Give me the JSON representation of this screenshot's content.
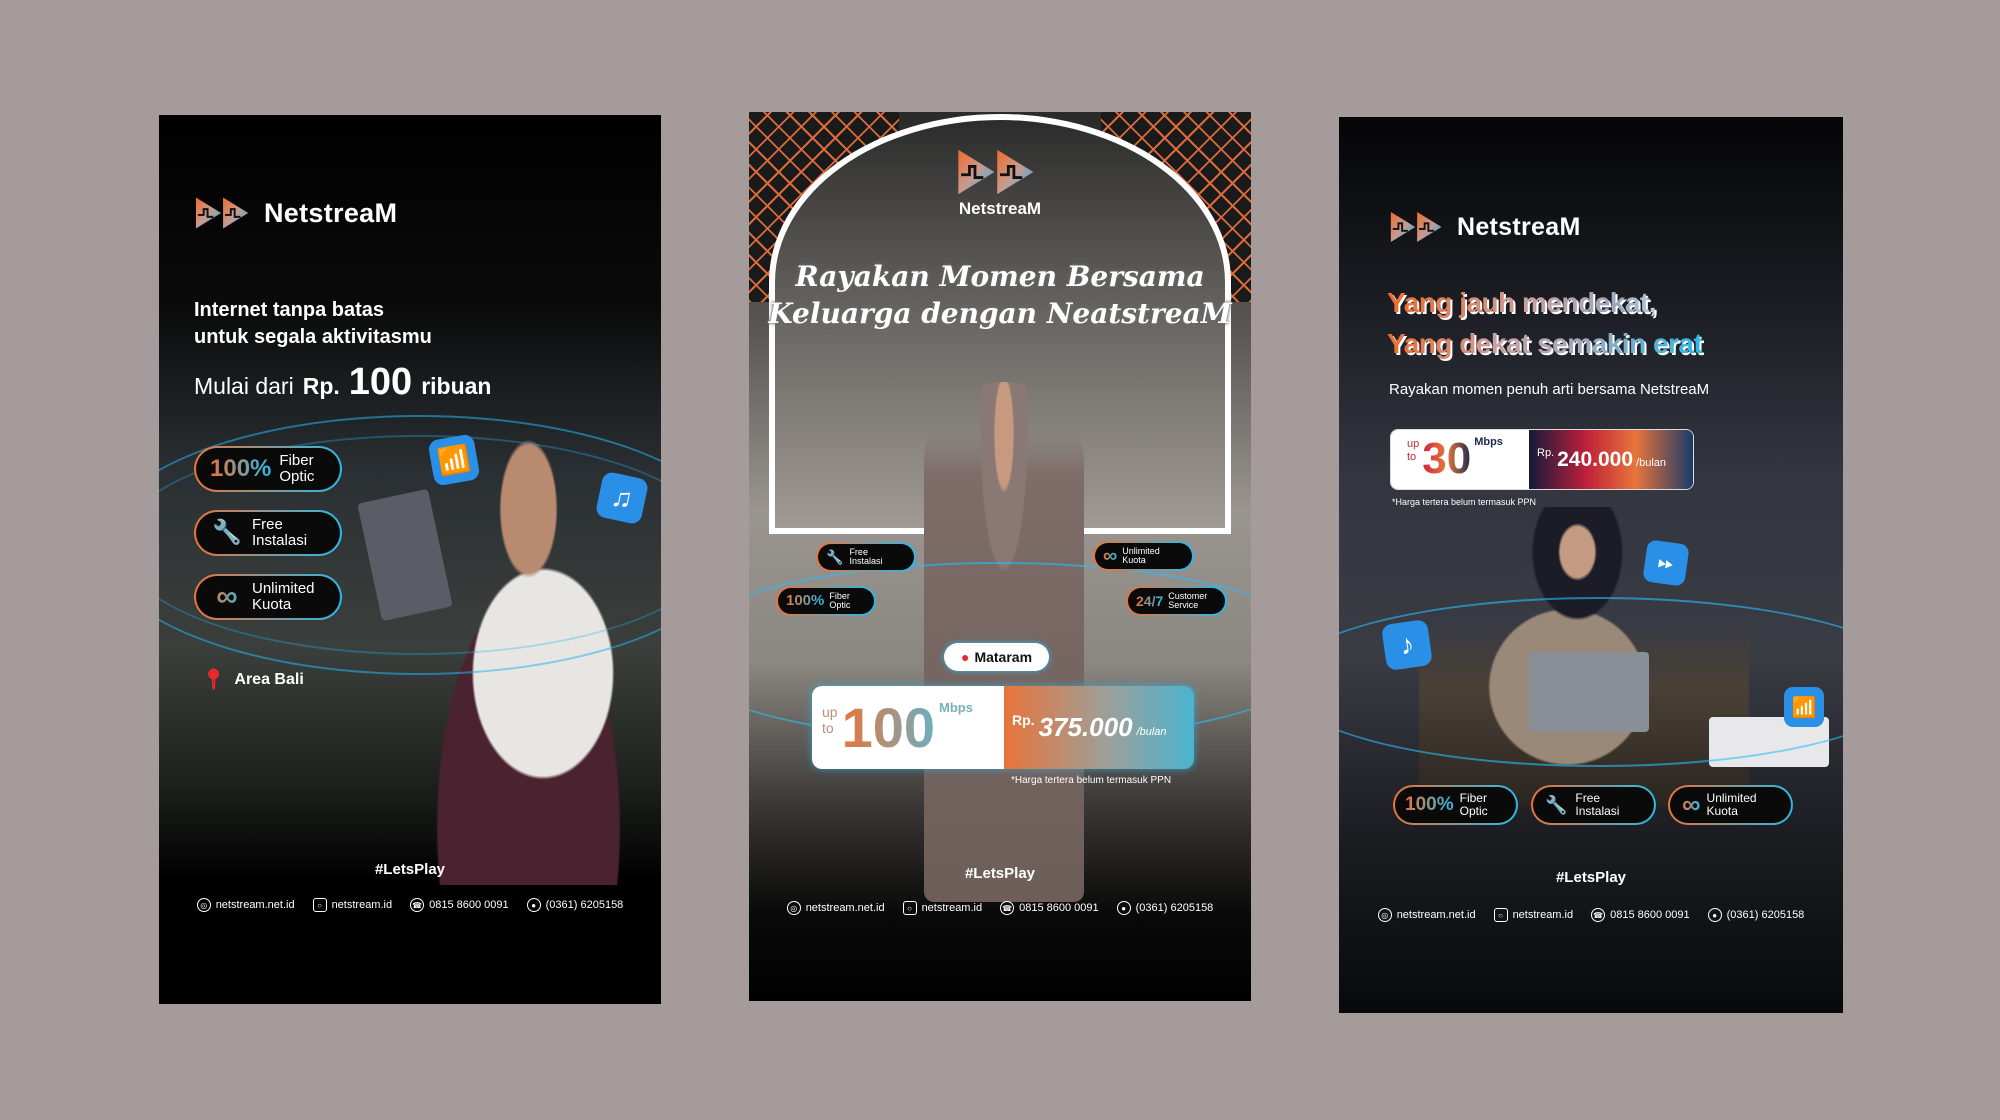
{
  "brand": "NetstreaM",
  "hashtag": "#LetsPlay",
  "contacts": {
    "website": "netstream.net.id",
    "instagram": "netstream.id",
    "whatsapp": "0815 8600 0091",
    "phone": "(0361) 6205158"
  },
  "features": {
    "fiber": {
      "big": "100%",
      "line1": "Fiber",
      "line2": "Optic"
    },
    "install": {
      "line1": "Free",
      "line2": "Instalasi"
    },
    "quota": {
      "line1": "Unlimited",
      "line2": "Kuota"
    },
    "service": {
      "big": "24/7",
      "line1": "Customer",
      "line2": "Service"
    }
  },
  "poster1": {
    "headline1": "Internet tanpa batas",
    "headline2": "untuk segala aktivitasmu",
    "price_prefix": "Mulai dari",
    "price_currency": "Rp.",
    "price_value": "100",
    "price_suffix": "ribuan",
    "area": "Area Bali"
  },
  "poster2": {
    "title1": "Rayakan Momen Bersama",
    "title2": "Keluarga dengan NeatstreaM",
    "location": "Mataram",
    "speed_prefix1": "up",
    "speed_prefix2": "to",
    "speed": "100",
    "speed_unit": "Mbps",
    "price_currency": "Rp.",
    "price": "375.000",
    "price_period": "/bulan",
    "note": "*Harga tertera belum termasuk PPN"
  },
  "poster3": {
    "headline1": "Yang jauh mendekat,",
    "headline2": "Yang dekat semakin erat",
    "subtitle": "Rayakan momen penuh arti bersama NetstreaM",
    "speed_prefix1": "up",
    "speed_prefix2": "to",
    "speed": "30",
    "speed_unit": "Mbps",
    "price_currency": "Rp.",
    "price": "240.000",
    "price_period": "/bulan",
    "note": "*Harga tertera belum termasuk PPN"
  },
  "colors": {
    "background": "#a69b9b",
    "orange": "#e8743b",
    "cyan": "#2bb8e8"
  }
}
